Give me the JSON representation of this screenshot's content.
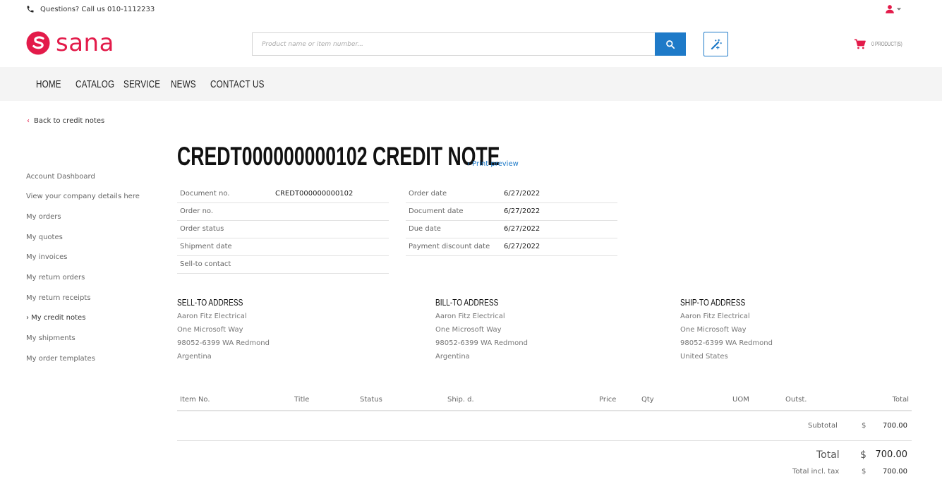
{
  "topbar": {
    "phone_text": "Questions? Call us 010-1112233"
  },
  "header": {
    "logo_text": "sana",
    "search_placeholder": "Product name or item number...",
    "cart_label": "0 PRODUCT(S)"
  },
  "nav": {
    "items": [
      "HOME",
      "CATALOG",
      "SERVICE",
      "NEWS",
      "CONTACT US"
    ]
  },
  "back_link": "Back to credit notes",
  "sidebar": {
    "items": [
      "Account Dashboard",
      "View your company details here",
      "My orders",
      "My quotes",
      "My invoices",
      "My return orders",
      "My return receipts",
      "› My credit notes",
      "My shipments",
      "My order templates"
    ]
  },
  "page": {
    "title": "CREDT000000000102 CREDIT NOTE",
    "print_preview": "› Print preview"
  },
  "info_left": [
    {
      "label": "Document no.",
      "value": "CREDT000000000102"
    },
    {
      "label": "Order no.",
      "value": ""
    },
    {
      "label": "Order status",
      "value": ""
    },
    {
      "label": "Shipment date",
      "value": ""
    },
    {
      "label": "Sell-to contact",
      "value": ""
    }
  ],
  "info_right": [
    {
      "label": "Order date",
      "value": "6/27/2022"
    },
    {
      "label": "Document date",
      "value": "6/27/2022"
    },
    {
      "label": "Due date",
      "value": "6/27/2022"
    },
    {
      "label": "Payment discount date",
      "value": "6/27/2022"
    }
  ],
  "addresses": {
    "sell_to": {
      "title": "SELL-TO ADDRESS",
      "lines": [
        "Aaron Fitz Electrical",
        "One Microsoft Way",
        "98052-6399 WA Redmond",
        "Argentina"
      ]
    },
    "bill_to": {
      "title": "BILL-TO ADDRESS",
      "lines": [
        "Aaron Fitz Electrical",
        "One Microsoft Way",
        "98052-6399 WA Redmond",
        "Argentina"
      ]
    },
    "ship_to": {
      "title": "SHIP-TO ADDRESS",
      "lines": [
        "Aaron Fitz Electrical",
        "One Microsoft Way",
        "98052-6399 WA Redmond",
        "United States"
      ]
    }
  },
  "lines_table": {
    "columns": [
      "Item No.",
      "Title",
      "Status",
      "Ship. d.",
      "Price",
      "Qty",
      "UOM",
      "Outst.",
      "Total"
    ]
  },
  "totals": {
    "subtotal_label": "Subtotal",
    "subtotal_currency": "$",
    "subtotal_value": "700.00",
    "total_label": "Total",
    "total_currency": "$",
    "total_value": "700.00",
    "total_incl_label": "Total incl. tax",
    "total_incl_currency": "$",
    "total_incl_value": "700.00"
  },
  "colors": {
    "brand": "#e31b4a",
    "accent": "#1e7ac8",
    "nav_bg": "#f4f4f4"
  }
}
